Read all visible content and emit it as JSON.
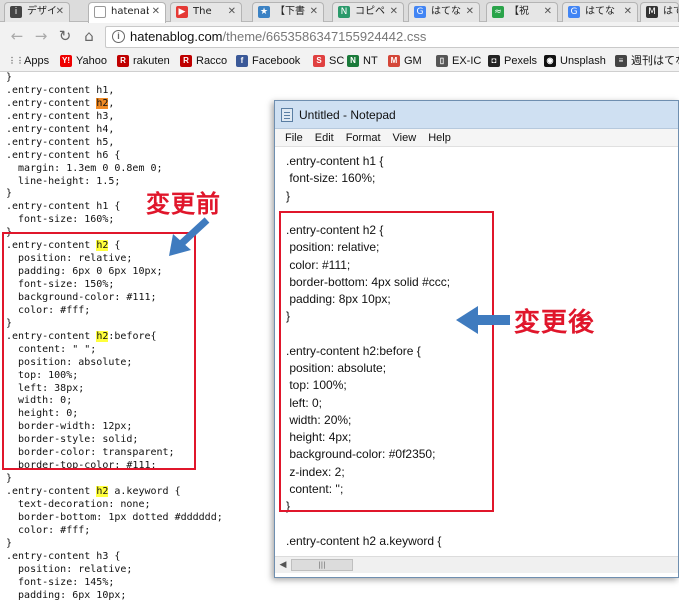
{
  "tabs": [
    {
      "title": "デザイ",
      "color": "#444",
      "icon": "i"
    },
    {
      "title": "hatenablog",
      "color": "#888",
      "icon": "📄"
    },
    {
      "title": "The",
      "color": "#e53935",
      "icon": "▶"
    },
    {
      "title": "【下書",
      "color": "#3b82c4",
      "icon": "★"
    },
    {
      "title": "コピペ",
      "color": "#2a9a6a",
      "icon": "N"
    },
    {
      "title": "はてな",
      "color": "#4285f4",
      "icon": "G"
    },
    {
      "title": "【祝",
      "color": "#2aa44a",
      "icon": "≈"
    },
    {
      "title": "はてな",
      "color": "#4285f4",
      "icon": "G"
    },
    {
      "title": "はて",
      "color": "#333",
      "icon": "M"
    }
  ],
  "toolbar": {
    "url_domain": "hatenablog.com",
    "url_path": "/theme/6653586347155924442.css"
  },
  "bookmarks": [
    {
      "label": "Apps",
      "icon": "apps-icon",
      "color": "#666"
    },
    {
      "label": "Yahoo",
      "icon": "Y!",
      "color": "#e00"
    },
    {
      "label": "rakuten",
      "icon": "R",
      "color": "#bf0000"
    },
    {
      "label": "Racco",
      "icon": "R",
      "color": "#bf0000"
    },
    {
      "label": "Facebook",
      "icon": "f",
      "color": "#3b5998"
    },
    {
      "label": "SC",
      "icon": "S",
      "color": "#e04040"
    },
    {
      "label": "NT",
      "icon": "N",
      "color": "#1a7a3a"
    },
    {
      "label": "GM",
      "icon": "M",
      "color": "#d44638"
    },
    {
      "label": "EX-IC",
      "icon": "▯",
      "color": "#555"
    },
    {
      "label": "Pexels",
      "icon": "◘",
      "color": "#222"
    },
    {
      "label": "Unsplash",
      "icon": "◉",
      "color": "#111"
    },
    {
      "label": "週刊はてな",
      "icon": "≡",
      "color": "#444"
    }
  ],
  "code_lines": [
    {
      "t": "}"
    },
    {
      "t": ".entry-content h1,"
    },
    {
      "a": ".entry-content ",
      "h": "h2",
      "b": ",",
      "hc": "o"
    },
    {
      "t": ".entry-content h3,"
    },
    {
      "t": ".entry-content h4,"
    },
    {
      "t": ".entry-content h5,"
    },
    {
      "t": ".entry-content h6 {"
    },
    {
      "t": "  margin: 1.3em 0 0.8em 0;"
    },
    {
      "t": "  line-height: 1.5;"
    },
    {
      "t": "}"
    },
    {
      "t": ".entry-content h1 {"
    },
    {
      "t": "  font-size: 160%;"
    },
    {
      "t": "}"
    },
    {
      "a": ".entry-content ",
      "h": "h2",
      "b": " {"
    },
    {
      "t": "  position: relative;"
    },
    {
      "t": "  padding: 6px 0 6px 10px;"
    },
    {
      "t": "  font-size: 150%;"
    },
    {
      "t": "  background-color: #111;"
    },
    {
      "t": "  color: #fff;"
    },
    {
      "t": "}"
    },
    {
      "a": ".entry-content ",
      "h": "h2",
      "b": ":before{"
    },
    {
      "t": "  content: \" \";"
    },
    {
      "t": "  position: absolute;"
    },
    {
      "t": "  top: 100%;"
    },
    {
      "t": "  left: 38px;"
    },
    {
      "t": "  width: 0;"
    },
    {
      "t": "  height: 0;"
    },
    {
      "t": "  border-width: 12px;"
    },
    {
      "t": "  border-style: solid;"
    },
    {
      "t": "  border-color: transparent;"
    },
    {
      "t": "  border-top-color: #111;"
    },
    {
      "t": "}"
    },
    {
      "a": ".entry-content ",
      "h": "h2",
      "b": " a.keyword {"
    },
    {
      "t": "  text-decoration: none;"
    },
    {
      "t": "  border-bottom: 1px dotted #dddddd;"
    },
    {
      "t": "  color: #fff;"
    },
    {
      "t": "}"
    },
    {
      "t": ".entry-content h3 {"
    },
    {
      "t": "  position: relative;"
    },
    {
      "t": "  font-size: 145%;"
    },
    {
      "t": "  padding: 6px 10px;"
    }
  ],
  "annotations": {
    "before": "変更前",
    "after": "変更後"
  },
  "notepad": {
    "title": "Untitled - Notepad",
    "menu": [
      "File",
      "Edit",
      "Format",
      "View",
      "Help"
    ],
    "lines": [
      ".entry-content h1 {",
      " font-size: 160%;",
      "}",
      "",
      ".entry-content h2 {",
      " position: relative;",
      " color: #111;",
      " border-bottom: 4px solid #ccc;",
      " padding: 8px 10px;",
      "}",
      "",
      ".entry-content h2:before {",
      " position: absolute;",
      " top: 100%;",
      " left: 0;",
      " width: 20%;",
      " height: 4px;",
      " background-color: #0f2350;",
      " z-index: 2;",
      " content: '';",
      "}",
      "",
      ".entry-content h2 a.keyword {"
    ]
  },
  "colors": {
    "annotation_red": "#e0162b",
    "arrow_blue": "#3f7bbf",
    "highlight_yellow": "#ffff3c",
    "highlight_orange": "#f08a24"
  }
}
